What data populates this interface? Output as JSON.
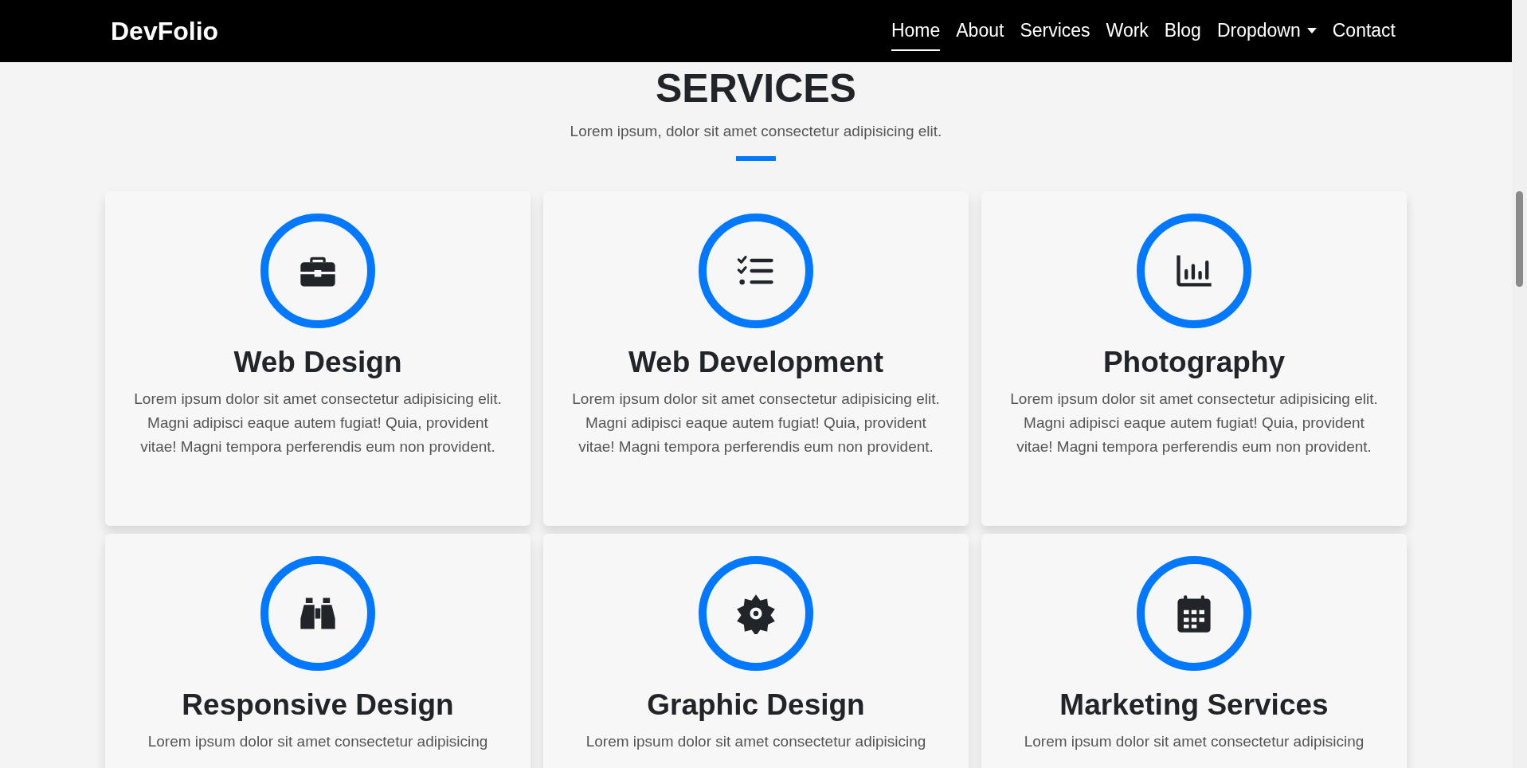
{
  "navbar": {
    "brand": "DevFolio",
    "links": [
      {
        "label": "Home",
        "selected": true,
        "dropdown": false
      },
      {
        "label": "About",
        "selected": false,
        "dropdown": false
      },
      {
        "label": "Services",
        "selected": false,
        "dropdown": false
      },
      {
        "label": "Work",
        "selected": false,
        "dropdown": false
      },
      {
        "label": "Blog",
        "selected": false,
        "dropdown": false
      },
      {
        "label": "Dropdown",
        "selected": false,
        "dropdown": true
      },
      {
        "label": "Contact",
        "selected": false,
        "dropdown": false
      }
    ]
  },
  "section": {
    "title": "SERVICES",
    "subtitle": "Lorem ipsum, dolor sit amet consectetur adipisicing elit.",
    "cards": [
      {
        "title": "Web Design",
        "text": "Lorem ipsum dolor sit amet consectetur adipisicing elit. Magni adipisci eaque autem fugiat! Quia, provident vitae! Magni tempora perferendis eum non provident."
      },
      {
        "title": "Web Development",
        "text": "Lorem ipsum dolor sit amet consectetur adipisicing elit. Magni adipisci eaque autem fugiat! Quia, provident vitae! Magni tempora perferendis eum non provident."
      },
      {
        "title": "Photography",
        "text": "Lorem ipsum dolor sit amet consectetur adipisicing elit. Magni adipisci eaque autem fugiat! Quia, provident vitae! Magni tempora perferendis eum non provident."
      },
      {
        "title": "Responsive Design",
        "text": "Lorem ipsum dolor sit amet consectetur adipisicing"
      },
      {
        "title": "Graphic Design",
        "text": "Lorem ipsum dolor sit amet consectetur adipisicing"
      },
      {
        "title": "Marketing Services",
        "text": "Lorem ipsum dolor sit amet consectetur adipisicing"
      }
    ]
  }
}
